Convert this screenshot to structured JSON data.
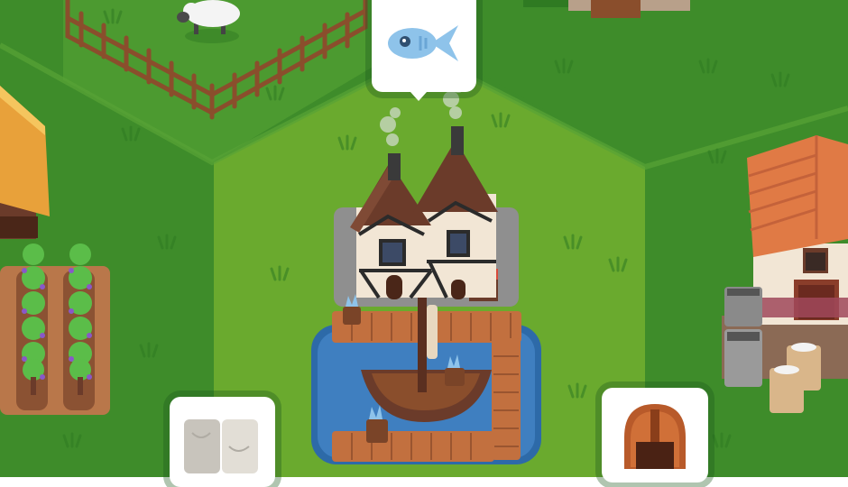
{
  "game": {
    "scene": "village",
    "selected_tile": "fishery",
    "resource_bubbles": [
      {
        "id": "fish",
        "icon": "fish-icon",
        "state": "ready"
      },
      {
        "id": "stone",
        "icon": "stone-slab-icon",
        "state": "ready"
      },
      {
        "id": "helmet",
        "icon": "helmet-icon",
        "state": "ready"
      }
    ]
  },
  "colors": {
    "grass_dark": "#3e8c2a",
    "grass_mid": "#4c9a30",
    "grass_light": "#6aaa2e",
    "water": "#3f7fc0",
    "wood": "#c2703f",
    "roof_brown": "#6b3b2a",
    "roof_orange": "#e07a45",
    "fish_blue": "#8ec3ea"
  }
}
